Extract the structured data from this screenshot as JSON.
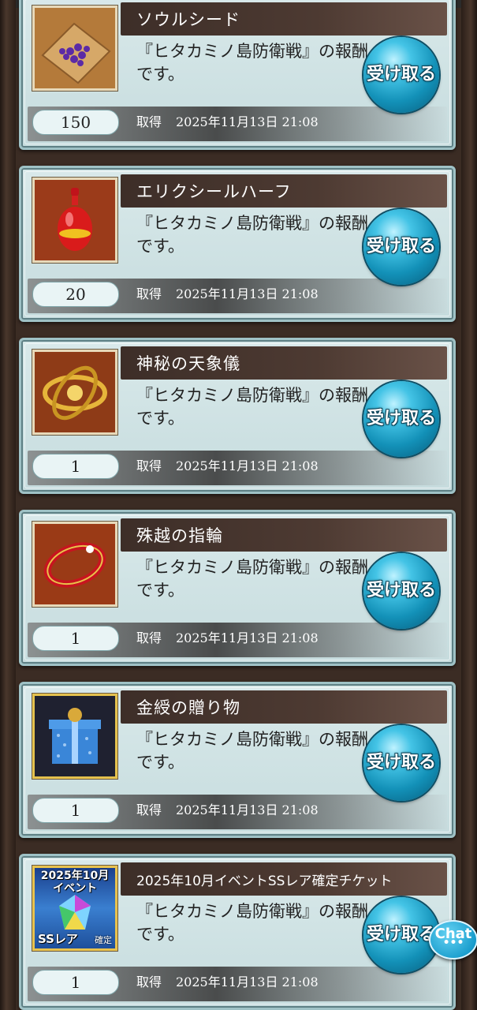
{
  "cards": [
    {
      "title": "ソウルシード",
      "message": "『ヒタカミノ島防衛戦』の報酬です。",
      "quantity": "150",
      "acquired_label": "取得",
      "acquired_at": "2025年11月13日 21:08",
      "button": "受け取る",
      "icon": "soul-seed-icon"
    },
    {
      "title": "エリクシールハーフ",
      "message": "『ヒタカミノ島防衛戦』の報酬です。",
      "quantity": "20",
      "acquired_label": "取得",
      "acquired_at": "2025年11月13日 21:08",
      "button": "受け取る",
      "icon": "elixir-bottle-icon"
    },
    {
      "title": "神秘の天象儀",
      "message": "『ヒタカミノ島防衛戦』の報酬です。",
      "quantity": "1",
      "acquired_label": "取得",
      "acquired_at": "2025年11月13日 21:08",
      "button": "受け取る",
      "icon": "armillary-sphere-icon"
    },
    {
      "title": "殊越の指輪",
      "message": "『ヒタカミノ島防衛戦』の報酬です。",
      "quantity": "1",
      "acquired_label": "取得",
      "acquired_at": "2025年11月13日 21:08",
      "button": "受け取る",
      "icon": "ring-icon"
    },
    {
      "title": "金綬の贈り物",
      "message": "『ヒタカミノ島防衛戦』の報酬です。",
      "quantity": "1",
      "acquired_label": "取得",
      "acquired_at": "2025年11月13日 21:08",
      "button": "受け取る",
      "icon": "gift-box-icon"
    },
    {
      "title": "2025年10月イベントSSレア確定チケット",
      "message": "『ヒタカミノ島防衛戦』の報酬です。",
      "quantity": "1",
      "acquired_label": "取得",
      "acquired_at": "2025年11月13日 21:08",
      "button": "受け取る",
      "icon": "ss-rare-ticket-icon",
      "icon_text": {
        "line1": "2025年10月",
        "line2": "イベント",
        "line3": "SSレア",
        "line4": "確定"
      }
    }
  ],
  "chat": {
    "label": "Chat",
    "dots": "•••"
  }
}
